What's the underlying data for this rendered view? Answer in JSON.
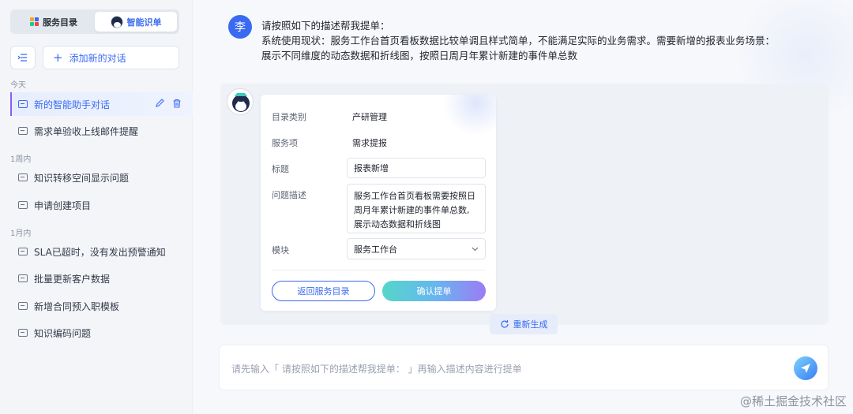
{
  "sidebar": {
    "tabs": [
      {
        "label": "服务目录",
        "active": false
      },
      {
        "label": "智能识单",
        "active": true
      }
    ],
    "new_chat_label": "添加新的对话",
    "groups": [
      {
        "label": "今天",
        "items": [
          {
            "label": "新的智能助手对话",
            "active": true
          },
          {
            "label": "需求单验收上线邮件提醒",
            "active": false
          }
        ]
      },
      {
        "label": "1周内",
        "items": [
          {
            "label": "知识转移空间显示问题"
          },
          {
            "label": "申请创建项目"
          }
        ]
      },
      {
        "label": "1月内",
        "items": [
          {
            "label": "SLA已超时，没有发出预警通知"
          },
          {
            "label": "批量更新客户数据"
          },
          {
            "label": "新增合同预入职模板"
          },
          {
            "label": "知识编码问题"
          }
        ]
      }
    ]
  },
  "user": {
    "avatar_text": "李",
    "message": [
      "请按照如下的描述帮我提单：",
      "系统使用现状：服务工作台首页看板数据比较单调且样式简单，不能满足实际的业务需求。需要新增的报表业务场景：",
      "展示不同维度的动态数据和折线图，按照日周月年累计新建的事件单总数"
    ]
  },
  "form": {
    "category_label": "目录类别",
    "category_value": "产研管理",
    "service_label": "服务项",
    "service_value": "需求提报",
    "title_label": "标题",
    "title_value": "报表新增",
    "desc_label": "问题描述",
    "desc_lines": [
      "服务工作台首页看板需要按照日",
      "周月年累计新建的事件单总数,",
      "展示动态数据和折线图"
    ],
    "module_label": "模块",
    "module_value": "服务工作台",
    "back_button": "返回服务目录",
    "confirm_button": "确认提单"
  },
  "regenerate_label": "重新生成",
  "composer": {
    "placeholder": "请先输入「 请按照如下的描述帮我提单： 」再输入描述内容进行提单"
  },
  "watermark": "@稀土掘金技术社区",
  "colors": {
    "accent": "#3a6af2",
    "sidebar_bg": "#f3f5f9",
    "active_border": "#8a5cf6"
  }
}
